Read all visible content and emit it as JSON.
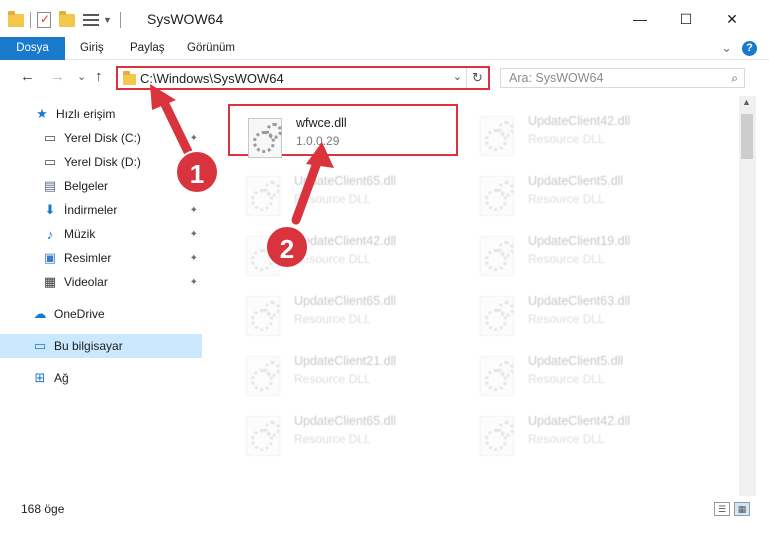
{
  "window": {
    "title": "SysWOW64",
    "minimize": "—",
    "maximize": "☐",
    "close": "✕"
  },
  "ribbon": {
    "tabs": [
      "Dosya",
      "Giriş",
      "Paylaş",
      "Görünüm"
    ],
    "collapse": "⌄",
    "help": "?"
  },
  "nav": {
    "back": "←",
    "forward": "→",
    "recent": "⌄",
    "up": "↑",
    "address": "C:\\Windows\\SysWOW64",
    "dropdown": "⌄",
    "refresh": "↻",
    "search_placeholder": "Ara: SysWOW64",
    "search_icon": "⌕"
  },
  "sidebar": {
    "items": [
      {
        "label": "Hızlı erişim",
        "icon": "star-icon",
        "glyph": "★",
        "color": "#1979ca",
        "pinned": false
      },
      {
        "label": "Yerel Disk (C:)",
        "icon": "drive-c-icon",
        "glyph": "▭",
        "color": "#4a4a4a",
        "pinned": true
      },
      {
        "label": "Yerel Disk (D:)",
        "icon": "drive-d-icon",
        "glyph": "▭",
        "color": "#4a4a4a",
        "pinned": true
      },
      {
        "label": "Belgeler",
        "icon": "documents-icon",
        "glyph": "▤",
        "color": "#5a6b8a",
        "pinned": true
      },
      {
        "label": "İndirmeler",
        "icon": "downloads-icon",
        "glyph": "⬇",
        "color": "#1979ca",
        "pinned": true
      },
      {
        "label": "Müzik",
        "icon": "music-icon",
        "glyph": "♪",
        "color": "#1979ca",
        "pinned": true
      },
      {
        "label": "Resimler",
        "icon": "pictures-icon",
        "glyph": "▣",
        "color": "#3f7cc4",
        "pinned": true
      },
      {
        "label": "Videolar",
        "icon": "videos-icon",
        "glyph": "▦",
        "color": "#3a3a3a",
        "pinned": true
      },
      {
        "label": "OneDrive",
        "icon": "onedrive-icon",
        "glyph": "☁",
        "color": "#1979ca",
        "pinned": false
      },
      {
        "label": "Bu bilgisayar",
        "icon": "this-pc-icon",
        "glyph": "▭",
        "color": "#1979ca",
        "pinned": false
      },
      {
        "label": "Ağ",
        "icon": "network-icon",
        "glyph": "⊞",
        "color": "#1979ca",
        "pinned": false
      }
    ],
    "pin_glyph": "📌"
  },
  "files": [
    {
      "name": "wfwce.dll",
      "desc": "1.0.0.29",
      "highlighted": true
    },
    {
      "name": "UpdateClient42.dll",
      "desc": "Resource DLL"
    },
    {
      "name": "UpdateClient65.dll",
      "desc": "Resource DLL"
    },
    {
      "name": "UpdateClient5.dll",
      "desc": "Resource DLL"
    },
    {
      "name": "UpdateClient42.dll",
      "desc": "Resource DLL"
    },
    {
      "name": "UpdateClient19.dll",
      "desc": "Resource DLL"
    },
    {
      "name": "UpdateClient65.dll",
      "desc": "Resource DLL"
    },
    {
      "name": "UpdateClient63.dll",
      "desc": "Resource DLL"
    },
    {
      "name": "UpdateClient21.dll",
      "desc": "Resource DLL"
    },
    {
      "name": "UpdateClient5.dll",
      "desc": "Resource DLL"
    },
    {
      "name": "UpdateClient65.dll",
      "desc": "Resource DLL"
    },
    {
      "name": "UpdateClient42.dll",
      "desc": "Resource DLL"
    }
  ],
  "status": {
    "count": "168 öge"
  },
  "annotations": {
    "step1": "1",
    "step2": "2",
    "color": "#d9343d"
  }
}
